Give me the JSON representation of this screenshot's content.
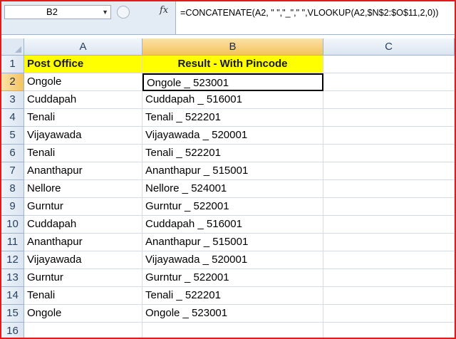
{
  "formula_bar": {
    "name_box": "B2",
    "fx_icon": "fx-icon",
    "formula": "=CONCATENATE(A2, \" \",\"_\",\" \",VLOOKUP(A2,$N$2:$O$11,2,0))"
  },
  "columns": [
    "A",
    "B",
    "C"
  ],
  "rows": [
    "1",
    "2",
    "3",
    "4",
    "5",
    "6",
    "7",
    "8",
    "9",
    "10",
    "11",
    "12",
    "13",
    "14",
    "15",
    "16"
  ],
  "header": {
    "a": "Post Office",
    "b": "Result - With Pincode"
  },
  "data": [
    [
      "Ongole",
      "Ongole _ 523001"
    ],
    [
      "Cuddapah",
      "Cuddapah _ 516001"
    ],
    [
      "Tenali",
      "Tenali _ 522201"
    ],
    [
      "Vijayawada",
      "Vijayawada _ 520001"
    ],
    [
      "Tenali",
      "Tenali _ 522201"
    ],
    [
      "Ananthapur",
      "Ananthapur _ 515001"
    ],
    [
      "Nellore",
      "Nellore _ 524001"
    ],
    [
      "Gurntur",
      "Gurntur _ 522001"
    ],
    [
      "Cuddapah",
      "Cuddapah _ 516001"
    ],
    [
      "Ananthapur",
      "Ananthapur _ 515001"
    ],
    [
      "Vijayawada",
      "Vijayawada _ 520001"
    ],
    [
      "Gurntur",
      "Gurntur _ 522001"
    ],
    [
      "Tenali",
      "Tenali _ 522201"
    ],
    [
      "Ongole",
      "Ongole _ 523001"
    ]
  ],
  "colors": {
    "accent_border": "#e01b1b",
    "header_fill": "#ffff00"
  }
}
